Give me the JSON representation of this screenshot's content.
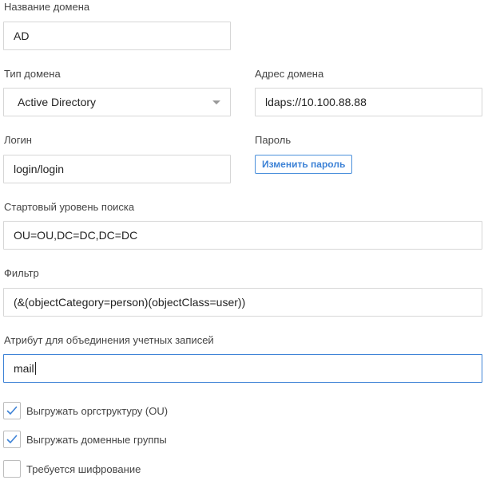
{
  "domain_name": {
    "label": "Название домена",
    "value": "AD"
  },
  "domain_type": {
    "label": "Тип домена",
    "value": "Active Directory"
  },
  "domain_address": {
    "label": "Адрес домена",
    "value": "ldaps://10.100.88.88"
  },
  "login": {
    "label": "Логин",
    "value": "login/login"
  },
  "password": {
    "label": "Пароль",
    "change_button": "Изменить пароль"
  },
  "search_base": {
    "label": "Стартовый уровень поиска",
    "value": "OU=OU,DC=DC,DC=DC"
  },
  "filter": {
    "label": "Фильтр",
    "value": "(&(objectCategory=person)(objectClass=user))"
  },
  "merge_attribute": {
    "label": "Атрибут для объединения учетных записей",
    "value": "mail"
  },
  "options": [
    {
      "label": "Выгружать оргструктуру (OU)",
      "checked": true
    },
    {
      "label": "Выгружать доменные группы",
      "checked": true
    },
    {
      "label": "Требуется шифрование",
      "checked": false
    }
  ],
  "colors": {
    "accent": "#3d82d6",
    "border": "#d6d6d6",
    "label_text": "#444444"
  }
}
